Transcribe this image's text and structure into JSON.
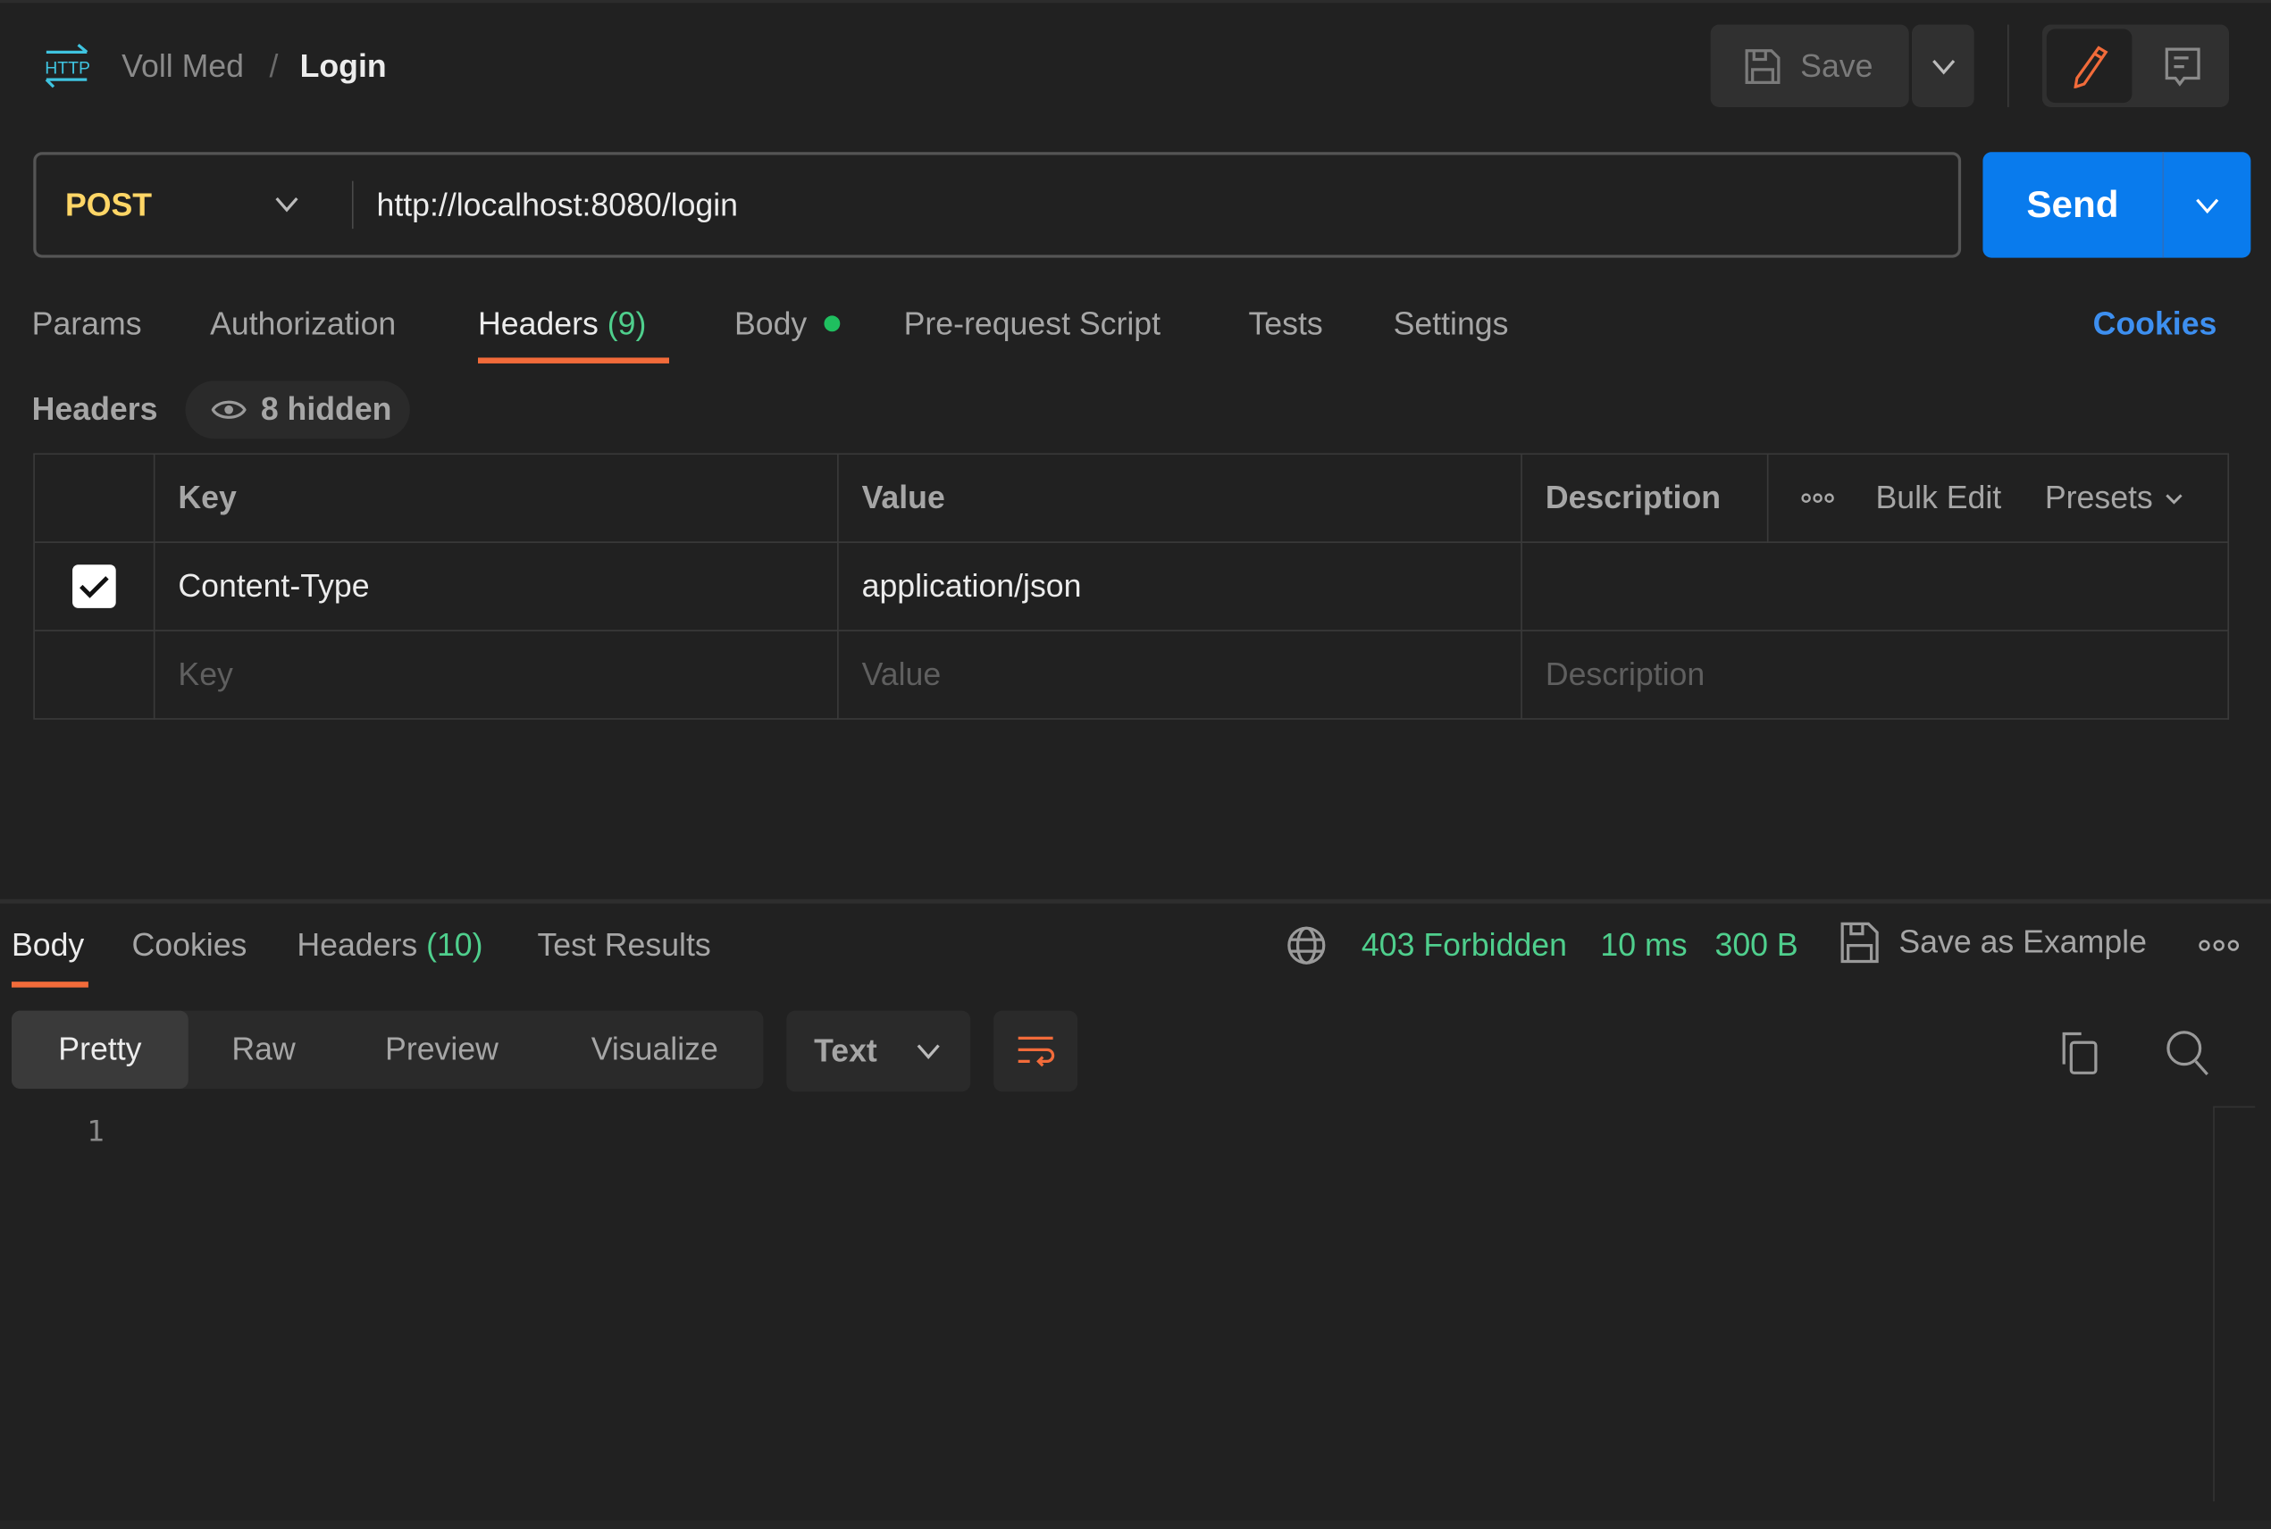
{
  "header": {
    "protocol_icon": "http-icon",
    "collection": "Voll Med",
    "separator": "/",
    "request_name": "Login",
    "save_label": "Save"
  },
  "request": {
    "method": "POST",
    "url": "http://localhost:8080/login",
    "send_label": "Send"
  },
  "tabs": [
    {
      "label": "Params"
    },
    {
      "label": "Authorization"
    },
    {
      "label": "Headers",
      "count": "(9)",
      "active": true
    },
    {
      "label": "Body",
      "has_dot": true
    },
    {
      "label": "Pre-request Script"
    },
    {
      "label": "Tests"
    },
    {
      "label": "Settings"
    }
  ],
  "cookies_link": "Cookies",
  "headers_section": {
    "title": "Headers",
    "hidden_label": "8 hidden",
    "columns": {
      "key": "Key",
      "value": "Value",
      "description": "Description"
    },
    "bulk_edit": "Bulk Edit",
    "presets": "Presets",
    "rows": [
      {
        "checked": true,
        "key": "Content-Type",
        "value": "application/json",
        "description": ""
      }
    ],
    "placeholders": {
      "key": "Key",
      "value": "Value",
      "description": "Description"
    }
  },
  "response": {
    "tabs": [
      {
        "label": "Body",
        "active": true
      },
      {
        "label": "Cookies"
      },
      {
        "label": "Headers",
        "count": "(10)"
      },
      {
        "label": "Test Results"
      }
    ],
    "status": "403 Forbidden",
    "time": "10 ms",
    "size": "300 B",
    "save_example": "Save as Example",
    "formats": [
      "Pretty",
      "Raw",
      "Preview",
      "Visualize"
    ],
    "active_format": "Pretty",
    "language": "Text",
    "line_numbers": [
      "1"
    ]
  },
  "colors": {
    "background": "#212121",
    "accent_orange": "#f26b3a",
    "send_blue": "#097bed",
    "status_green": "#4fcf8d",
    "method_yellow": "#ffd666",
    "link_blue": "#3d8ff0"
  }
}
